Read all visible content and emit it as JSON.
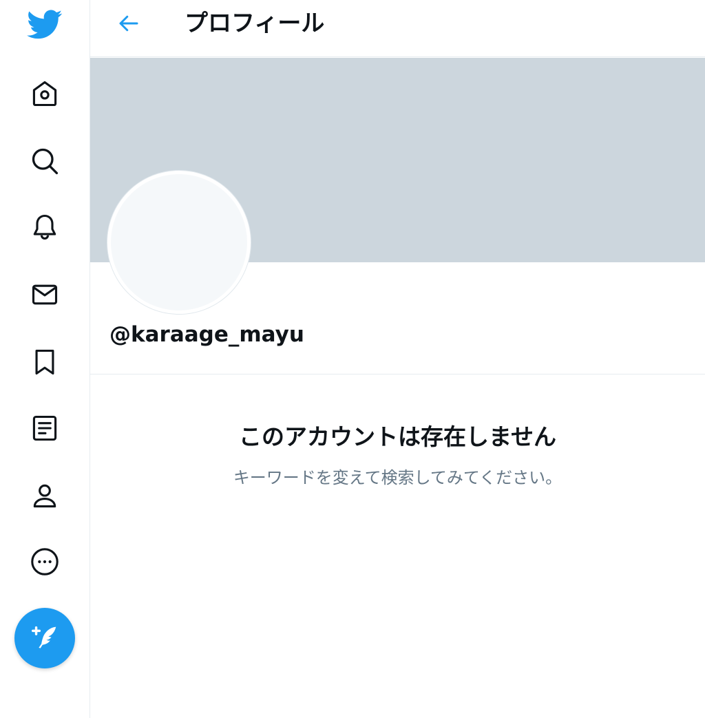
{
  "header": {
    "title": "プロフィール",
    "back_icon": "arrow-left-icon"
  },
  "sidebar": {
    "items": [
      {
        "icon": "twitter-bird-icon",
        "label": "Twitter"
      },
      {
        "icon": "home-icon",
        "label": "Home"
      },
      {
        "icon": "search-icon",
        "label": "Explore"
      },
      {
        "icon": "bell-icon",
        "label": "Notifications"
      },
      {
        "icon": "mail-icon",
        "label": "Messages"
      },
      {
        "icon": "bookmark-icon",
        "label": "Bookmarks"
      },
      {
        "icon": "list-icon",
        "label": "Lists"
      },
      {
        "icon": "person-icon",
        "label": "Profile"
      },
      {
        "icon": "more-icon",
        "label": "More"
      }
    ],
    "compose_icon": "compose-tweet-icon"
  },
  "profile": {
    "handle": "@karaage_mayu"
  },
  "empty_state": {
    "title": "このアカウントは存在しません",
    "subtitle": "キーワードを変えて検索してみてください。"
  },
  "colors": {
    "accent": "#1d9bf0",
    "banner": "#ccd6dd",
    "secondary_text": "#657786",
    "border": "#e6ecf0"
  }
}
